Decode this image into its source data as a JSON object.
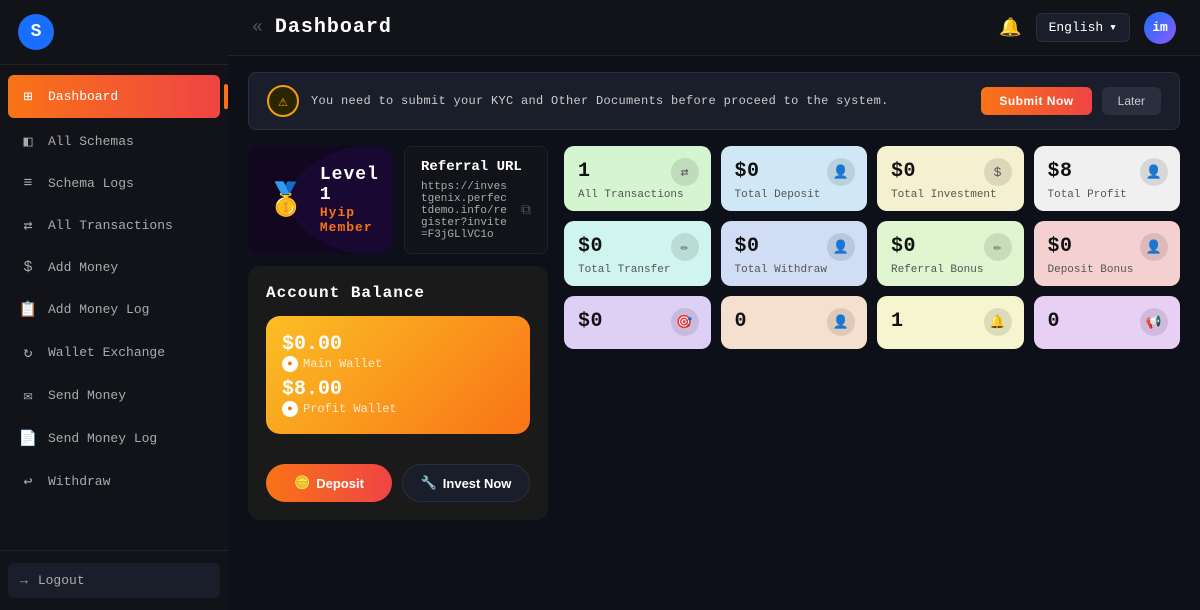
{
  "sidebar": {
    "logo": "S",
    "nav_items": [
      {
        "id": "dashboard",
        "label": "Dashboard",
        "icon": "⊞",
        "active": true
      },
      {
        "id": "all-schemas",
        "label": "All Schemas",
        "icon": "◧"
      },
      {
        "id": "schema-logs",
        "label": "Schema Logs",
        "icon": "≡"
      },
      {
        "id": "all-transactions",
        "label": "All Transactions",
        "icon": "⇄"
      },
      {
        "id": "add-money",
        "label": "Add Money",
        "icon": "$"
      },
      {
        "id": "add-money-log",
        "label": "Add Money Log",
        "icon": "📋"
      },
      {
        "id": "wallet-exchange",
        "label": "Wallet Exchange",
        "icon": "↻"
      },
      {
        "id": "send-money",
        "label": "Send Money",
        "icon": "✉"
      },
      {
        "id": "send-money-log",
        "label": "Send Money Log",
        "icon": "📄"
      },
      {
        "id": "withdraw",
        "label": "Withdraw",
        "icon": "↩"
      }
    ],
    "logout_label": "Logout"
  },
  "header": {
    "title": "Dashboard",
    "arrows_icon": "«",
    "language": "English",
    "chevron_icon": "▾",
    "avatar_text": "im"
  },
  "kyc": {
    "text": "You need to submit your KYC and Other Documents before proceed to the system.",
    "submit_label": "Submit Now",
    "later_label": "Later"
  },
  "level": {
    "medal_icon": "🥇",
    "title": "Level 1",
    "subtitle": "Hyip Member"
  },
  "referral": {
    "title": "Referral URL",
    "url": "https://investgenix.perfectdemo.info/register?invite=F3jGLlVC1o",
    "copy_icon": "⧉"
  },
  "balance": {
    "title": "Account Balance",
    "main_wallet_amount": "$0.00",
    "main_wallet_label": "Main Wallet",
    "profit_wallet_amount": "$8.00",
    "profit_wallet_label": "Profit Wallet",
    "deposit_label": "Deposit",
    "invest_label": "Invest Now",
    "coin_symbol": "●"
  },
  "stats": {
    "row1": [
      {
        "value": "1",
        "label": "All Transactions",
        "bg": "green",
        "icon": "⇄"
      },
      {
        "value": "$0",
        "label": "Total Deposit",
        "bg": "blue",
        "icon": "👤"
      },
      {
        "value": "$0",
        "label": "Total Investment",
        "bg": "yellow",
        "icon": "$"
      },
      {
        "value": "$8",
        "label": "Total Profit",
        "bg": "white-bg",
        "icon": "👤"
      }
    ],
    "row2": [
      {
        "value": "$0",
        "label": "Total Transfer",
        "bg": "mint",
        "icon": "✏"
      },
      {
        "value": "$0",
        "label": "Total Withdraw",
        "bg": "light-blue",
        "icon": "👤"
      },
      {
        "value": "$0",
        "label": "Referral Bonus",
        "bg": "light-green",
        "icon": "✏"
      },
      {
        "value": "$0",
        "label": "Deposit Bonus",
        "bg": "light-pink",
        "icon": "👤"
      }
    ],
    "row3": [
      {
        "value": "$0",
        "label": "",
        "bg": "lavender",
        "icon": "🎯"
      },
      {
        "value": "0",
        "label": "",
        "bg": "peach",
        "icon": "👤"
      },
      {
        "value": "1",
        "label": "",
        "bg": "light-yellow",
        "icon": "🔔"
      },
      {
        "value": "0",
        "label": "",
        "bg": "purple-light",
        "icon": "📢"
      }
    ]
  }
}
